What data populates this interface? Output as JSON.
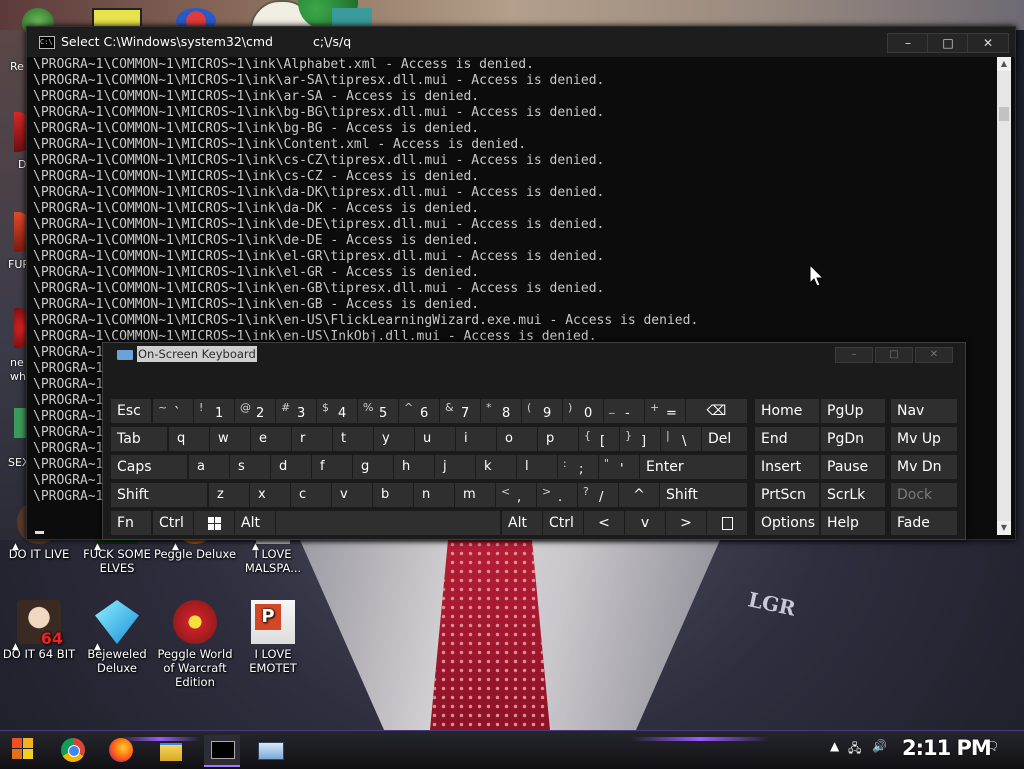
{
  "cmd": {
    "title": "Select C:\\Windows\\system32\\cmd",
    "title_tail": "c;\\/s/q",
    "lines": [
      "\\PROGRA~1\\COMMON~1\\MICROS~1\\ink\\Alphabet.xml - Access is denied.",
      "\\PROGRA~1\\COMMON~1\\MICROS~1\\ink\\ar-SA\\tipresx.dll.mui - Access is denied.",
      "\\PROGRA~1\\COMMON~1\\MICROS~1\\ink\\ar-SA - Access is denied.",
      "\\PROGRA~1\\COMMON~1\\MICROS~1\\ink\\bg-BG\\tipresx.dll.mui - Access is denied.",
      "\\PROGRA~1\\COMMON~1\\MICROS~1\\ink\\bg-BG - Access is denied.",
      "\\PROGRA~1\\COMMON~1\\MICROS~1\\ink\\Content.xml - Access is denied.",
      "\\PROGRA~1\\COMMON~1\\MICROS~1\\ink\\cs-CZ\\tipresx.dll.mui - Access is denied.",
      "\\PROGRA~1\\COMMON~1\\MICROS~1\\ink\\cs-CZ - Access is denied.",
      "\\PROGRA~1\\COMMON~1\\MICROS~1\\ink\\da-DK\\tipresx.dll.mui - Access is denied.",
      "\\PROGRA~1\\COMMON~1\\MICROS~1\\ink\\da-DK - Access is denied.",
      "\\PROGRA~1\\COMMON~1\\MICROS~1\\ink\\de-DE\\tipresx.dll.mui - Access is denied.",
      "\\PROGRA~1\\COMMON~1\\MICROS~1\\ink\\de-DE - Access is denied.",
      "\\PROGRA~1\\COMMON~1\\MICROS~1\\ink\\el-GR\\tipresx.dll.mui - Access is denied.",
      "\\PROGRA~1\\COMMON~1\\MICROS~1\\ink\\el-GR - Access is denied.",
      "\\PROGRA~1\\COMMON~1\\MICROS~1\\ink\\en-GB\\tipresx.dll.mui - Access is denied.",
      "\\PROGRA~1\\COMMON~1\\MICROS~1\\ink\\en-GB - Access is denied.",
      "\\PROGRA~1\\COMMON~1\\MICROS~1\\ink\\en-US\\FlickLearningWizard.exe.mui - Access is denied.",
      "\\PROGRA~1\\COMMON~1\\MICROS~1\\ink\\en-US\\InkObj.dll.mui - Access is denied.",
      "\\PROGRA~1",
      "\\PROGRA~1",
      "\\PROGRA~1",
      "\\PROGRA~1",
      "\\PROGRA~1",
      "\\PROGRA~1",
      "\\PROGRA~1",
      "\\PROGRA~1",
      "\\PROGRA~1",
      "\\PROGRA~1"
    ]
  },
  "osk": {
    "title": "On-Screen Keyboard",
    "keys": {
      "esc": "Esc",
      "tilde_sup": "~",
      "tilde_main": "`",
      "k1_sup": "!",
      "k1": "1",
      "k2_sup": "@",
      "k2": "2",
      "k3_sup": "#",
      "k3": "3",
      "k4_sup": "$",
      "k4": "4",
      "k5_sup": "%",
      "k5": "5",
      "k6_sup": "^",
      "k6": "6",
      "k7_sup": "&",
      "k7": "7",
      "k8_sup": "*",
      "k8": "8",
      "k9_sup": "(",
      "k9": "9",
      "k0_sup": ")",
      "k0": "0",
      "minus_sup": "_",
      "minus": "-",
      "plus_sup": "+",
      "equals": "=",
      "backspace": "⌫",
      "tab": "Tab",
      "q": "q",
      "w": "w",
      "e": "e",
      "r": "r",
      "t": "t",
      "y": "y",
      "u": "u",
      "i": "i",
      "o": "o",
      "p": "p",
      "lbrace_sup": "{",
      "lbrace": "[",
      "rbrace_sup": "}",
      "rbrace": "]",
      "pipe_sup": "|",
      "backslash": "\\",
      "del": "Del",
      "caps": "Caps",
      "a": "a",
      "s": "s",
      "d": "d",
      "f": "f",
      "g": "g",
      "h": "h",
      "j": "j",
      "k": "k",
      "l": "l",
      "colon_sup": ":",
      "semicolon": ";",
      "quote_sup": "\"",
      "quote": "'",
      "enter": "Enter",
      "shift_l": "Shift",
      "z": "z",
      "x": "x",
      "c": "c",
      "v": "v",
      "b": "b",
      "n": "n",
      "m": "m",
      "lt_sup": "<",
      "comma": ",",
      "gt_sup": ">",
      "period": ".",
      "q_sup": "?",
      "slash": "/",
      "up": "^",
      "shift_r": "Shift",
      "fn": "Fn",
      "ctrl_l": "Ctrl",
      "alt_l": "Alt",
      "alt_r": "Alt",
      "ctrl_r": "Ctrl",
      "left": "<",
      "down": "v",
      "right": ">",
      "home": "Home",
      "pgup": "PgUp",
      "nav": "Nav",
      "end": "End",
      "pgdn": "PgDn",
      "mvup": "Mv Up",
      "insert": "Insert",
      "pause": "Pause",
      "mvdn": "Mv Dn",
      "prtscn": "PrtScn",
      "scrlk": "ScrLk",
      "dock": "Dock",
      "options": "Options",
      "help": "Help",
      "fade": "Fade"
    }
  },
  "desktop_icons": [
    {
      "label": "DO IT LIVE"
    },
    {
      "label": "FUCK SOME ELVES"
    },
    {
      "label": "Peggle Deluxe"
    },
    {
      "label": "I LOVE MALSPA..."
    },
    {
      "label": "DO IT 64 BIT"
    },
    {
      "label": "Bejeweled Deluxe"
    },
    {
      "label": "Peggle World of Warcraft Edition"
    },
    {
      "label": "I LOVE EMOTET"
    }
  ],
  "left_icon_fragments": {
    "re": "Re",
    "d": "D",
    "fur": "FUR",
    "ne": "ne",
    "wh": "wh",
    "sex": "SEX"
  },
  "desktop_pin_text": "LGR",
  "taskbar": {
    "clock": "2:11 PM"
  },
  "colors": {
    "console_bg": "#0c0c0c",
    "console_text": "#c8c8c8",
    "osk_key": "#2f2f2f",
    "accent_purple": "#9b59ff"
  }
}
